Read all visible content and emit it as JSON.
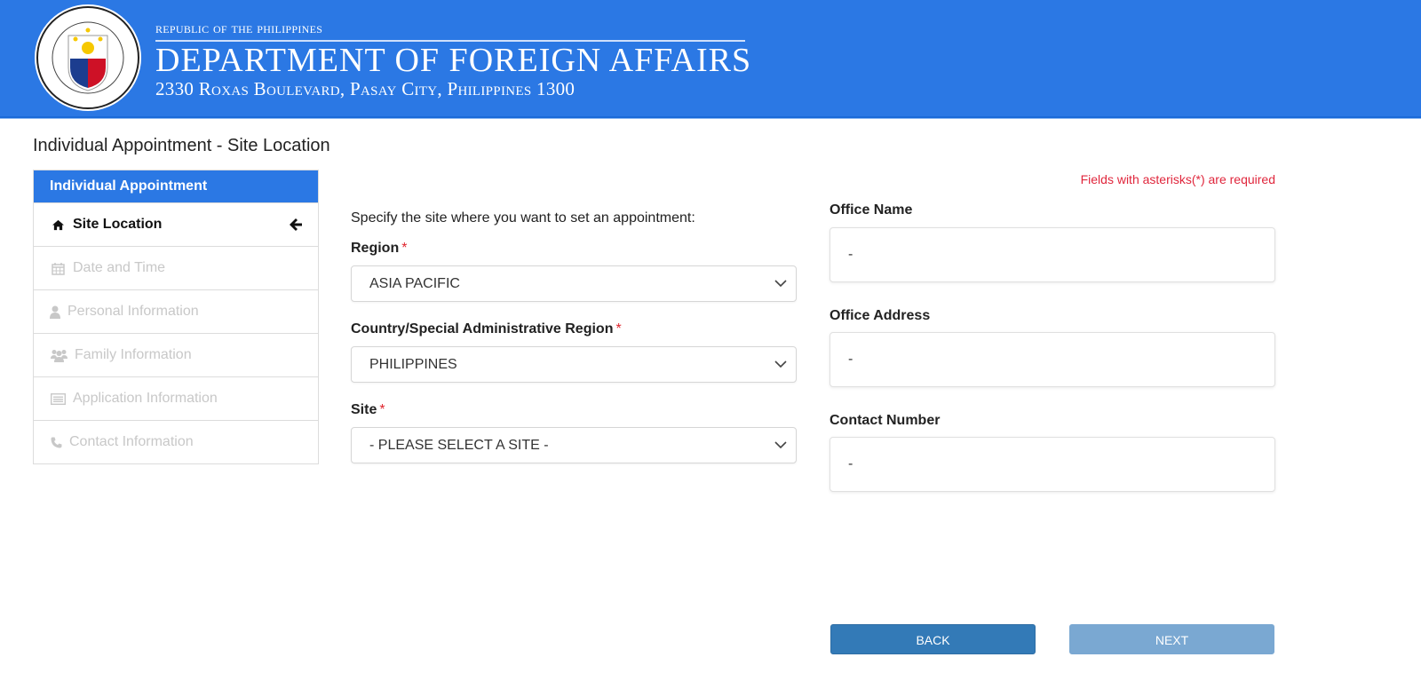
{
  "header": {
    "seal_alt": "Department of Foreign Affairs seal",
    "republic": "Republic of the Philippines",
    "department": "DEPARTMENT OF FOREIGN AFFAIRS",
    "address": "2330 Roxas Boulevard, Pasay City, Philippines 1300",
    "brand_color": "#2b78e4"
  },
  "page": {
    "title": "Individual Appointment - Site Location"
  },
  "sidebar": {
    "heading": "Individual Appointment",
    "items": [
      {
        "label": "Site Location",
        "icon": "home-icon",
        "active": true
      },
      {
        "label": "Date and Time",
        "icon": "calendar-icon",
        "active": false
      },
      {
        "label": "Personal Information",
        "icon": "user-icon",
        "active": false
      },
      {
        "label": "Family Information",
        "icon": "users-icon",
        "active": false
      },
      {
        "label": "Application Information",
        "icon": "list-alt-icon",
        "active": false
      },
      {
        "label": "Contact Information",
        "icon": "phone-icon",
        "active": false
      }
    ],
    "active_indicator_icon": "arrow-left-icon"
  },
  "form": {
    "intro": "Specify the site where you want to set an appointment:",
    "required_note": "Fields with asterisks(*) are required",
    "required_marker": "*",
    "region": {
      "label": "Region",
      "value": "ASIA PACIFIC"
    },
    "country": {
      "label": "Country/Special Administrative Region",
      "value": "PHILIPPINES"
    },
    "site": {
      "label": "Site",
      "value": "- PLEASE SELECT A SITE -"
    }
  },
  "office": {
    "name": {
      "label": "Office Name",
      "value": "-"
    },
    "address": {
      "label": "Office Address",
      "value": "-"
    },
    "contact": {
      "label": "Contact Number",
      "value": "-"
    }
  },
  "actions": {
    "back_label": "BACK",
    "next_label": "NEXT"
  }
}
